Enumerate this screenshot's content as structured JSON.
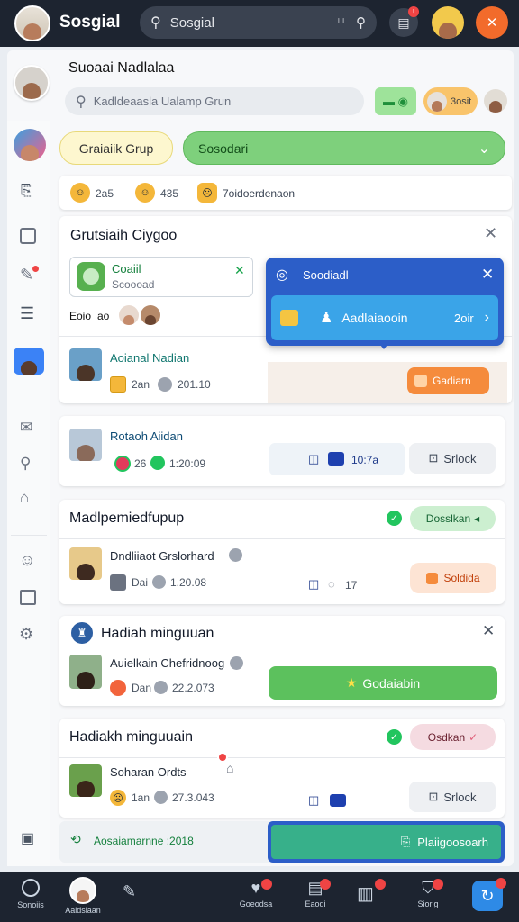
{
  "topbar": {
    "app_name": "Sosgial",
    "search_value": "Sosgial",
    "notif_badge": "!",
    "badge_red": "#ef4444",
    "brand_color": "#1d2430"
  },
  "profile": {
    "name": "Suoaai Nadlalaa",
    "search_placeholder": "Kadldeaasla Ualamp Grun",
    "score_label": "3osit"
  },
  "filters": {
    "group_label": "Graiaiik Grup",
    "dropdown_label": "Sosodari"
  },
  "reactions": [
    {
      "icon": "smile-emoji",
      "count": "2a5"
    },
    {
      "icon": "grin-emoji",
      "count": "435"
    },
    {
      "icon": "neutral-emoji",
      "count": "7oidoerdenaon"
    }
  ],
  "group_card": {
    "title": "Grutsiaih Ciygoo",
    "notice_title": "Coaiil",
    "notice_sub": "Scoooad",
    "members_text": "Eoio",
    "members_count": "ao",
    "row": {
      "name": "Aoianal Nadian",
      "meta_count": "2an",
      "meta_time": "201.10",
      "action": "Gadiarn"
    }
  },
  "popup": {
    "title": "Soodiadl",
    "action_label": "Aadlaiaooin",
    "action_count": "2oir"
  },
  "card2": {
    "name": "Rotaoh Aiidan",
    "count": "26",
    "time": "1:20:09",
    "time2": "10:7a",
    "action": "Srlock"
  },
  "card3": {
    "title": "Madlpemiedfupup",
    "status": "Dosslkan",
    "name": "Dndliiaot Grslorhard",
    "meta_count": "Dai",
    "meta_time": "1.20.08",
    "meta_num": "17",
    "action": "Soldida"
  },
  "card4": {
    "title": "Hadiah minguuan",
    "name": "Auielkain Chefridnoog",
    "meta_count": "Dan",
    "meta_time": "22.2.073",
    "action": "Godaiabin"
  },
  "card5": {
    "title": "Hadiakh minguuain",
    "status": "Osdkan",
    "name": "Soharan Ordts",
    "meta_count": "1an",
    "meta_time": "27.3.043",
    "action": "Srlock"
  },
  "footer_strip": {
    "text": "Aosaiamarnne :2018",
    "action": "Plaiigoosoarh"
  },
  "bottom_nav": [
    {
      "label": "Sonoiis"
    },
    {
      "label": "Aaidslaan"
    },
    {
      "label": ""
    },
    {
      "label": "Goeodsa"
    },
    {
      "label": "Eaodi"
    },
    {
      "label": ""
    },
    {
      "label": "Siorig"
    },
    {
      "label": ""
    }
  ]
}
